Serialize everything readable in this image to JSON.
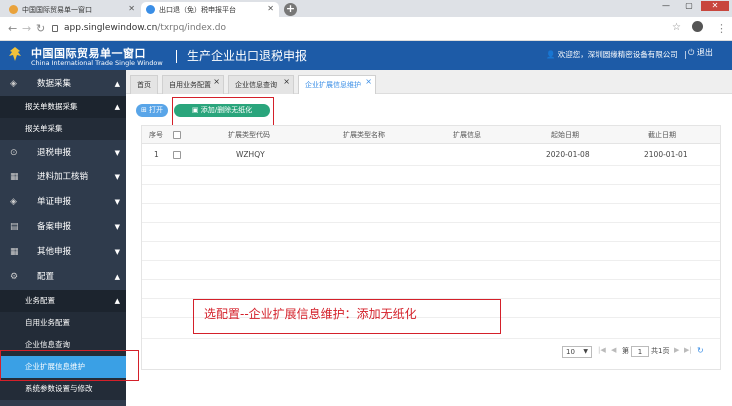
{
  "browser": {
    "tabs": [
      {
        "label": "中国国际贸易单一窗口",
        "active": false
      },
      {
        "label": "出口退（免）税申报平台",
        "active": true
      }
    ],
    "new_tab": "+",
    "url_host": "app.singlewindow.cn",
    "url_path": "/txrpq/index.do",
    "win_minimize": "—",
    "win_maximize": "▢",
    "win_close": "✕"
  },
  "header": {
    "title_cn": "中国国际贸易单一窗口",
    "title_en": "China International Trade Single Window",
    "system_name": "生产企业出口退税申报",
    "user_text": "欢迎您，深圳圆缘精密设备有限公司",
    "logout": "退出"
  },
  "sidebar": {
    "items": [
      {
        "label": "数据采集",
        "arrow": "▲"
      },
      {
        "label": "报关单数据采集",
        "arrow": "▲"
      },
      {
        "label": "报关单采集"
      },
      {
        "label": "退税申报",
        "arrow": "▼"
      },
      {
        "label": "进料加工核销",
        "arrow": "▼"
      },
      {
        "label": "单证申报",
        "arrow": "▼"
      },
      {
        "label": "备案申报",
        "arrow": "▼"
      },
      {
        "label": "其他申报",
        "arrow": "▼"
      },
      {
        "label": "配置",
        "arrow": "▲"
      },
      {
        "label": "业务配置",
        "arrow": "▲"
      },
      {
        "label": "自用业务配置"
      },
      {
        "label": "企业信息查询"
      },
      {
        "label": "企业扩展信息维护"
      },
      {
        "label": "系统参数设置与修改"
      }
    ]
  },
  "page_tabs": [
    {
      "label": "首页"
    },
    {
      "label": "自用业务配置",
      "close": "×"
    },
    {
      "label": "企业信息查询",
      "close": "×"
    },
    {
      "label": "企业扩展信息维护",
      "close": "×"
    }
  ],
  "toolbar": {
    "open_label": "打开",
    "add_label": "添加/删除无纸化"
  },
  "table": {
    "columns": [
      "序号",
      "扩展类型代码",
      "扩展类型名称",
      "扩展信息",
      "起始日期",
      "截止日期"
    ],
    "rows": [
      {
        "seq": "1",
        "code": "WZHQY",
        "name": "",
        "info": "",
        "start": "2020-01-08",
        "end": "2100-01-01"
      }
    ]
  },
  "pager": {
    "page_size": "10",
    "page_prefix": "第",
    "page": "1",
    "total": "共1页"
  },
  "annotation": "选配置--企业扩展信息维护：添加无纸化",
  "colors": {
    "header_blue": "#1d5ba7",
    "sidebar": "#2f3b4c",
    "active_item": "#3aa0e5",
    "add_button": "#2aa57c",
    "highlight_red": "#d4202a"
  }
}
